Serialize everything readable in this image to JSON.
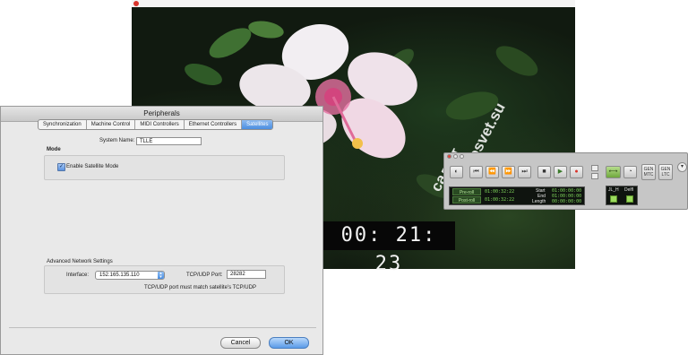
{
  "video": {
    "timecode": "00: 21: 23",
    "watermark": "салют\nmuzprosvet.su"
  },
  "peripherals": {
    "title": "Peripherals",
    "tabs": [
      {
        "label": "Synchronization",
        "active": false
      },
      {
        "label": "Machine Control",
        "active": false
      },
      {
        "label": "MIDI Controllers",
        "active": false
      },
      {
        "label": "Ethernet Controllers",
        "active": false
      },
      {
        "label": "Satellites",
        "active": true
      }
    ],
    "system_name_label": "System Name:",
    "system_name_value": "TLLE",
    "mode_heading": "Mode",
    "enable_satellite_label": "Enable Satellite Mode",
    "enable_satellite_checked": true,
    "network_heading": "Advanced Network Settings",
    "interface_label": "Interface:",
    "interface_value": "152.165.135.110",
    "port_label": "TCP/UDP Port:",
    "port_value": "28282",
    "port_note": "TCP/UDP port must match satellite's TCP/UDP",
    "cancel_label": "Cancel",
    "ok_label": "OK"
  },
  "transport": {
    "buttons": [
      "online-icon",
      "return-to-zero-icon",
      "rewind-icon",
      "fast-forward-icon",
      "go-to-end-icon",
      "stop-icon",
      "play-icon",
      "record-icon"
    ],
    "gen_mtc": "GEN\nMTC",
    "gen_ltc": "GEN\nLTC",
    "preroll_label": "Pre-roll",
    "postroll_label": "Post-roll",
    "preroll_value": "01:00:32:22",
    "postroll_value": "01:00:32:22",
    "start_label": "Start",
    "end_label": "End",
    "length_label": "Length",
    "start_value": "01:00:00:00",
    "end_value": "01:00:00:00",
    "length_value": "00:00:00:00",
    "midi_in_label": "JL_H",
    "midi_out_label": "Delfl"
  },
  "colors": {
    "timecode_bg": "#070707",
    "tab_active": "#4b8ee0",
    "counter_green": "#7fd65b",
    "record_red": "#d9342b"
  }
}
